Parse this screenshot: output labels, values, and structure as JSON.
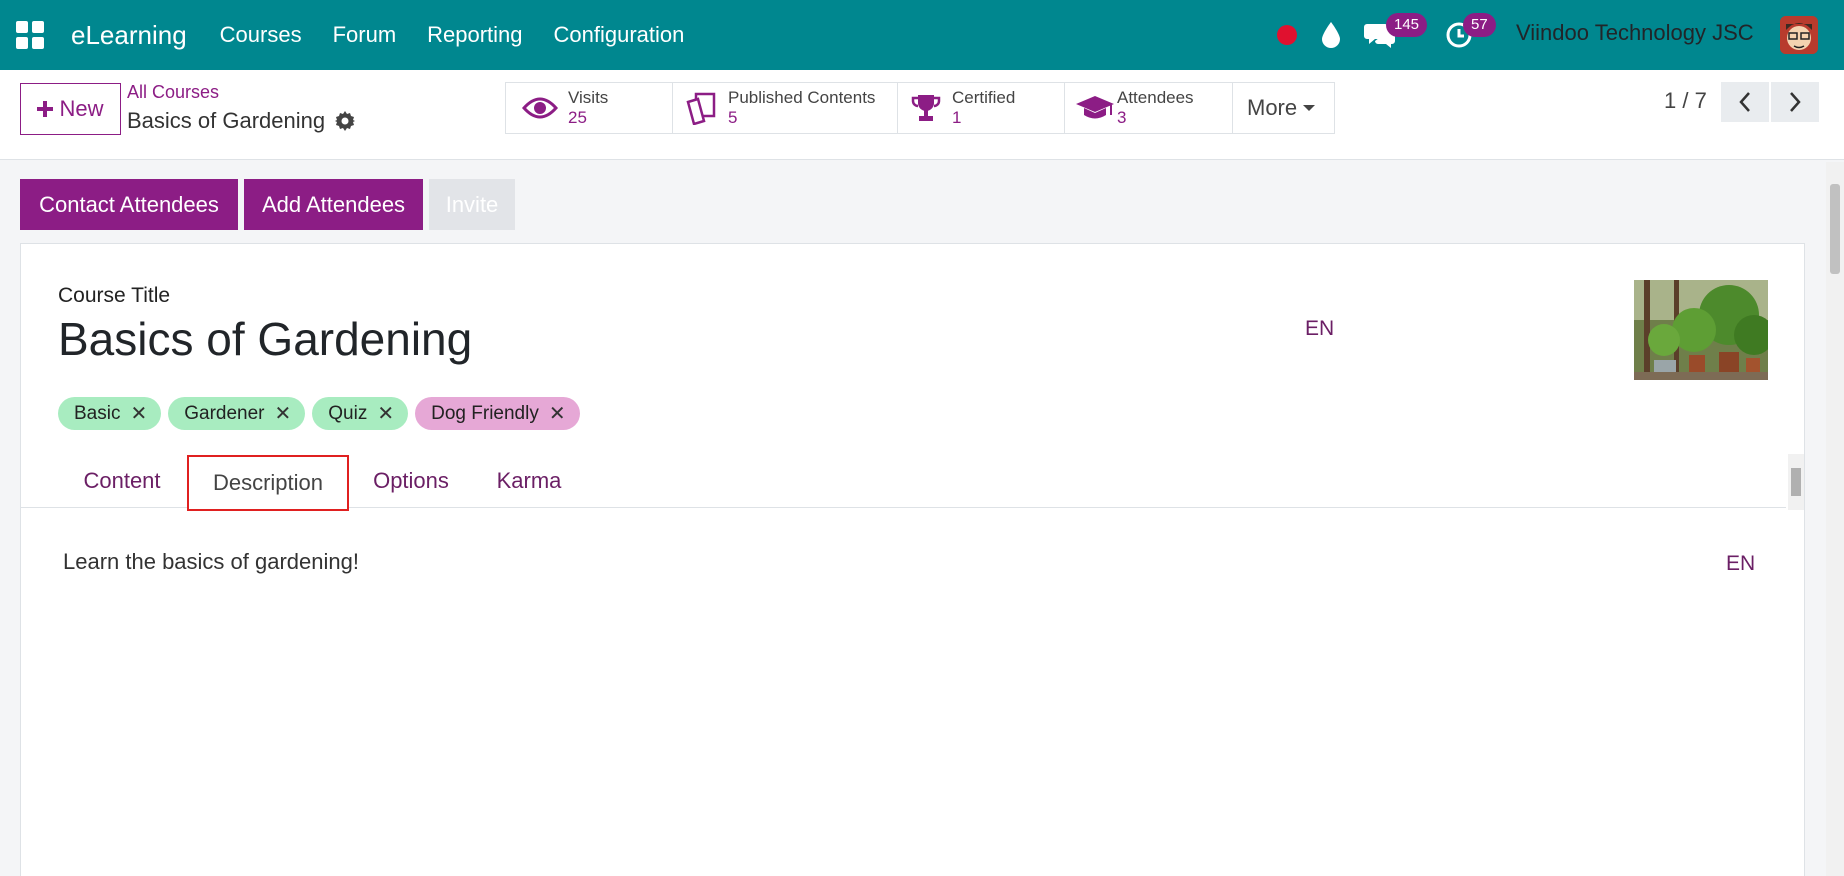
{
  "navbar": {
    "app_name": "eLearning",
    "menu": [
      "Courses",
      "Forum",
      "Reporting",
      "Configuration"
    ],
    "messages_count": "145",
    "activities_count": "57",
    "company": "Viindoo Technology JSC"
  },
  "control": {
    "new_label": "New",
    "breadcrumb": "All Courses",
    "record_name": "Basics of Gardening",
    "stats": [
      {
        "label": "Visits",
        "value": "25"
      },
      {
        "label": "Published Contents",
        "value": "5"
      },
      {
        "label": "Certified",
        "value": "1"
      },
      {
        "label": "Attendees",
        "value": "3"
      }
    ],
    "more_label": "More",
    "pager": "1 / 7"
  },
  "actions": {
    "contact": "Contact Attendees",
    "add": "Add Attendees",
    "invite": "Invite"
  },
  "form": {
    "title_label": "Course Title",
    "title": "Basics of Gardening",
    "lang": "EN",
    "tags": [
      {
        "name": "Basic",
        "color": "#a8ecc0"
      },
      {
        "name": "Gardener",
        "color": "#a8ecc0"
      },
      {
        "name": "Quiz",
        "color": "#a8ecc0"
      },
      {
        "name": "Dog Friendly",
        "color": "#e6a8d6"
      }
    ],
    "tabs": [
      "Content",
      "Description",
      "Options",
      "Karma"
    ],
    "active_tab": "Description",
    "description": "Learn the basics of gardening!",
    "desc_lang": "EN"
  },
  "colors": {
    "navbar": "#00878f",
    "primary": "#8c1d85",
    "highlight": "#e02020"
  }
}
